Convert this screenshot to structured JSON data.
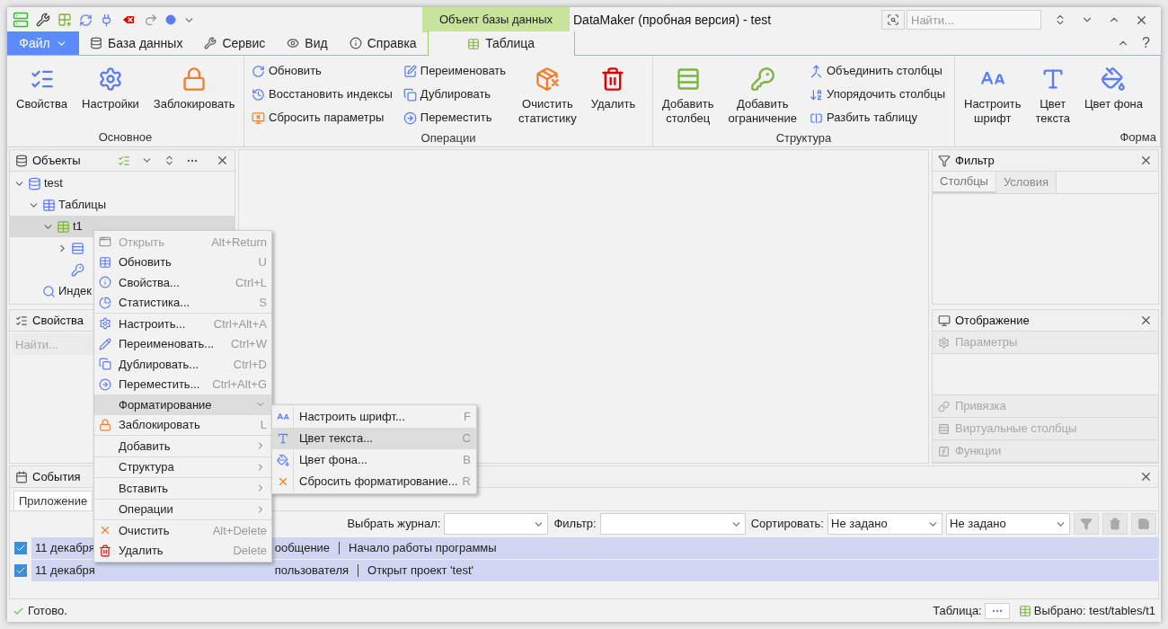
{
  "window": {
    "context_group": "Объект базы данных",
    "title": "DataMaker (пробная версия) - test",
    "search_placeholder": "Найти...",
    "help_button": "?"
  },
  "file_button": "Файл",
  "tabs": [
    {
      "label": "База данных",
      "selected": false
    },
    {
      "label": "Сервис",
      "selected": false
    },
    {
      "label": "Вид",
      "selected": false
    },
    {
      "label": "Справка",
      "selected": false
    },
    {
      "label": "Таблица",
      "selected": true
    }
  ],
  "ribbon": [
    {
      "label": "Основное",
      "items": [
        {
          "kind": "large",
          "label": [
            "Свойства"
          ]
        },
        {
          "kind": "large",
          "label": [
            "Настройки"
          ]
        },
        {
          "kind": "large",
          "label": [
            "Заблокировать"
          ]
        }
      ]
    },
    {
      "label": "Операции",
      "items": [
        {
          "kind": "small",
          "label": [
            "Обновить"
          ]
        },
        {
          "kind": "small",
          "label": [
            "Восстановить индексы"
          ]
        },
        {
          "kind": "small",
          "label": [
            "Сбросить параметры"
          ]
        },
        {
          "kind": "small",
          "label": [
            "Переименовать"
          ]
        },
        {
          "kind": "small",
          "label": [
            "Дублировать"
          ]
        },
        {
          "kind": "small",
          "label": [
            "Переместить"
          ]
        },
        {
          "kind": "large",
          "label": [
            "Очистить",
            "статистику"
          ]
        },
        {
          "kind": "large",
          "label": [
            "Удалить"
          ]
        }
      ]
    },
    {
      "label": "Структура",
      "items": [
        {
          "kind": "large",
          "label": [
            "Добавить",
            "столбец"
          ]
        },
        {
          "kind": "large",
          "label": [
            "Добавить",
            "ограничение"
          ]
        },
        {
          "kind": "small",
          "label": [
            "Объединить столбцы"
          ]
        },
        {
          "kind": "small",
          "label": [
            "Упорядочить столбцы"
          ]
        },
        {
          "kind": "small",
          "label": [
            "Разбить таблицу"
          ]
        }
      ]
    },
    {
      "label": "Форма",
      "items": [
        {
          "kind": "large",
          "label": [
            "Настроить",
            "шрифт"
          ]
        },
        {
          "kind": "large",
          "label": [
            "Цвет",
            "текста"
          ]
        },
        {
          "kind": "large",
          "label": [
            "Цвет фона"
          ]
        }
      ]
    }
  ],
  "objects_panel": {
    "title": "Объекты",
    "tree": [
      {
        "label": "test",
        "kind": "database",
        "expanded": true,
        "selected": false,
        "children": [
          {
            "label": "Таблицы",
            "kind": "table-group",
            "expanded": true,
            "selected": false,
            "children": [
              {
                "label": "t1",
                "kind": "table",
                "expanded": true,
                "selected": true,
                "children": [
                  {
                    "kind": "columns",
                    "expanded": false,
                    "selected": false
                  },
                  {
                    "kind": "keys",
                    "selected": false
                  }
                ]
              }
            ]
          },
          {
            "label": "Индек",
            "kind": "indexes",
            "selected": false
          }
        ]
      }
    ]
  },
  "properties_panel": {
    "title": "Свойства",
    "search_placeholder": "Найти..."
  },
  "filter_panel": {
    "title": "Фильтр",
    "tabs": [
      {
        "label": "Столбцы",
        "selected": true
      },
      {
        "label": "Условия",
        "selected": false
      }
    ]
  },
  "display_panel": {
    "title": "Отображение",
    "top_sections": [
      {
        "label": "Параметры",
        "disabled": true
      }
    ],
    "bottom_sections": [
      {
        "label": "Привязка",
        "disabled": true
      },
      {
        "label": "Виртуальные столбцы",
        "disabled": true
      },
      {
        "label": "Функции",
        "disabled": true
      }
    ]
  },
  "events_panel": {
    "title": "События",
    "tabs": [
      {
        "label": "Приложение",
        "selected": true
      }
    ],
    "log_label": "Выбрать журнал:",
    "filter_label": "Фильтр:",
    "sort_label": "Сортировать:",
    "sort_values": [
      "Не задано",
      "Не задано"
    ],
    "rows": [
      {
        "checked": true,
        "date": "11 декабря",
        "type": "ообщение",
        "message": "Начало работы программы"
      },
      {
        "checked": true,
        "date": "11 декабря",
        "type": "пользователя",
        "message": "Открыт проект 'test'"
      }
    ]
  },
  "status": {
    "text": "Готово.",
    "table_label": "Таблица:",
    "selection": "Выбрано: test/tables/t1"
  },
  "context_menu": {
    "sections": [
      [
        {
          "label": "Открыть",
          "shortcut": "Alt+Return",
          "disabled": true,
          "selected": false
        },
        {
          "label": "Обновить",
          "shortcut": "U",
          "disabled": false,
          "selected": false
        },
        {
          "label": "Свойства...",
          "shortcut": "Ctrl+L",
          "disabled": false,
          "selected": false
        },
        {
          "label": "Статистика...",
          "shortcut": "S",
          "disabled": false,
          "selected": false
        }
      ],
      [
        {
          "label": "Настроить...",
          "shortcut": "Ctrl+Alt+A",
          "disabled": false,
          "selected": false
        },
        {
          "label": "Переименовать...",
          "shortcut": "Ctrl+W",
          "disabled": false,
          "selected": false
        },
        {
          "label": "Дублировать...",
          "shortcut": "Ctrl+D",
          "disabled": false,
          "selected": false
        },
        {
          "label": "Переместить...",
          "shortcut": "Ctrl+Alt+G",
          "disabled": false,
          "selected": false
        },
        {
          "label": "Форматирование",
          "kind": "submenu",
          "expanded": true,
          "disabled": false,
          "selected": true
        },
        {
          "label": "Заблокировать",
          "shortcut": "L",
          "disabled": false,
          "selected": false
        }
      ],
      [
        {
          "label": "Добавить",
          "kind": "submenu",
          "expanded": false,
          "disabled": false,
          "selected": false
        }
      ],
      [
        {
          "label": "Структура",
          "kind": "submenu",
          "expanded": false,
          "disabled": false,
          "selected": false
        }
      ],
      [
        {
          "label": "Вставить",
          "kind": "submenu",
          "expanded": false,
          "disabled": false,
          "selected": false
        }
      ],
      [
        {
          "label": "Операции",
          "kind": "submenu",
          "expanded": false,
          "disabled": false,
          "selected": false
        }
      ],
      [
        {
          "label": "Очистить",
          "shortcut": "Alt+Delete",
          "disabled": false,
          "selected": false
        },
        {
          "label": "Удалить",
          "shortcut": "Delete",
          "disabled": false,
          "selected": false
        }
      ]
    ]
  },
  "submenu": {
    "items": [
      {
        "label": "Настроить шрифт...",
        "shortcut": "F",
        "selected": false
      },
      {
        "label": "Цвет текста...",
        "shortcut": "C",
        "selected": true
      },
      {
        "label": "Цвет фона...",
        "shortcut": "B",
        "selected": false
      },
      {
        "label": "Сбросить форматирование...",
        "shortcut": "R",
        "selected": false
      }
    ]
  }
}
